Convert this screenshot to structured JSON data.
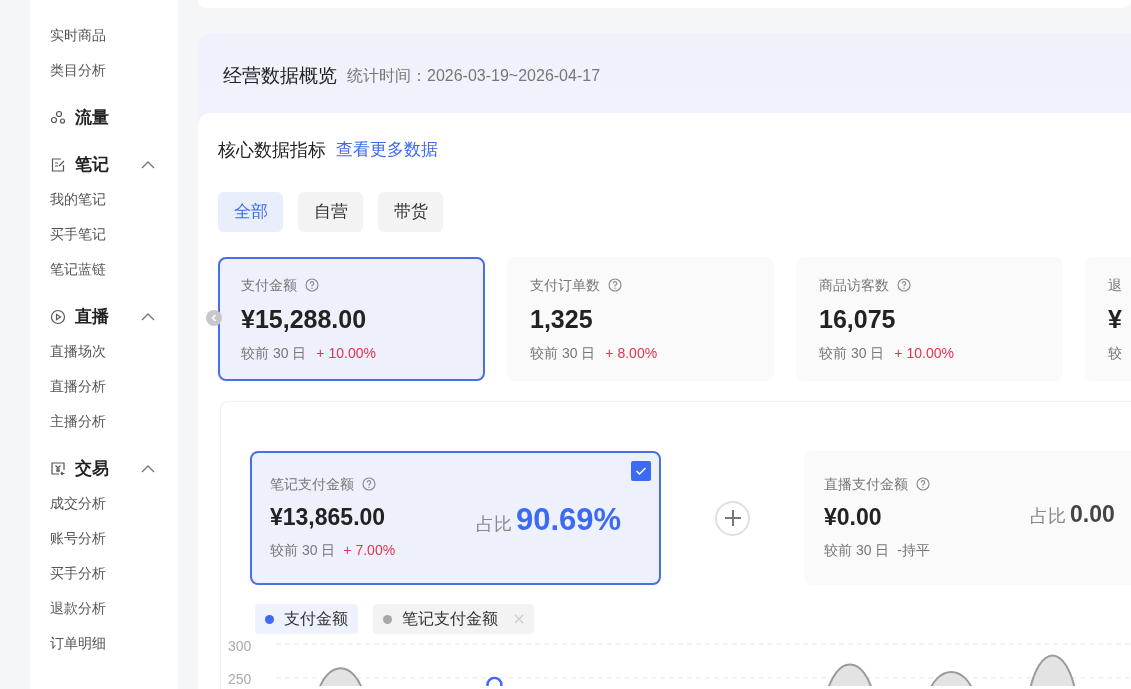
{
  "sidebar": [
    {
      "kind": "item",
      "label": "实时商品"
    },
    {
      "kind": "item",
      "label": "类目分析"
    },
    {
      "kind": "section",
      "label": "流量"
    },
    {
      "kind": "section",
      "label": "笔记",
      "expanded": true
    },
    {
      "kind": "item",
      "label": "我的笔记"
    },
    {
      "kind": "item",
      "label": "买手笔记"
    },
    {
      "kind": "item",
      "label": "笔记蓝链"
    },
    {
      "kind": "section",
      "label": "直播",
      "expanded": true
    },
    {
      "kind": "item",
      "label": "直播场次"
    },
    {
      "kind": "item",
      "label": "直播分析"
    },
    {
      "kind": "item",
      "label": "主播分析"
    },
    {
      "kind": "section",
      "label": "交易",
      "expanded": true
    },
    {
      "kind": "item",
      "label": "成交分析"
    },
    {
      "kind": "item",
      "label": "账号分析"
    },
    {
      "kind": "item",
      "label": "买手分析"
    },
    {
      "kind": "item",
      "label": "退款分析"
    },
    {
      "kind": "item",
      "label": "订单明细"
    }
  ],
  "overview": {
    "title": "经营数据概览",
    "period": "统计时间：2026-03-19~2026-04-17"
  },
  "core": {
    "title": "核心数据指标",
    "more_link": "查看更多数据"
  },
  "tabs": [
    {
      "label": "全部",
      "selected": true
    },
    {
      "label": "自营",
      "selected": false
    },
    {
      "label": "带货",
      "selected": false
    }
  ],
  "metrics": [
    {
      "label": "支付金额",
      "value": "¥15,288.00",
      "compare": "较前 30 日",
      "delta": "+ 10.00%",
      "selected": true
    },
    {
      "label": "支付订单数",
      "value": "1,325",
      "compare": "较前 30 日",
      "delta": "+ 8.00%",
      "selected": false
    },
    {
      "label": "商品访客数",
      "value": "16,075",
      "compare": "较前 30 日",
      "delta": "+ 10.00%",
      "selected": false
    },
    {
      "label": "退",
      "value": "¥",
      "compare": "较",
      "selected": false
    }
  ],
  "breakdown": [
    {
      "label": "笔记支付金额",
      "value": "¥13,865.00",
      "compare": "较前 30 日",
      "delta": "+ 7.00%",
      "color": "#e0344f",
      "share_label": "占比",
      "share": "90.69%",
      "selected": true,
      "checked": true
    },
    {
      "label": "直播支付金额",
      "value": "¥0.00",
      "compare": "较前 30 日",
      "delta": "-持平",
      "color": "#777777",
      "share_label": "占比",
      "share": "0.00",
      "selected": false,
      "checked": false
    }
  ],
  "legend": [
    {
      "label": "支付金额",
      "color": "#3d6af5",
      "removable": false
    },
    {
      "label": "笔记支付金额",
      "color": "#a8a8a8",
      "removable": true
    }
  ],
  "chart": {
    "y_axis_labels": [
      "300",
      "250"
    ]
  }
}
